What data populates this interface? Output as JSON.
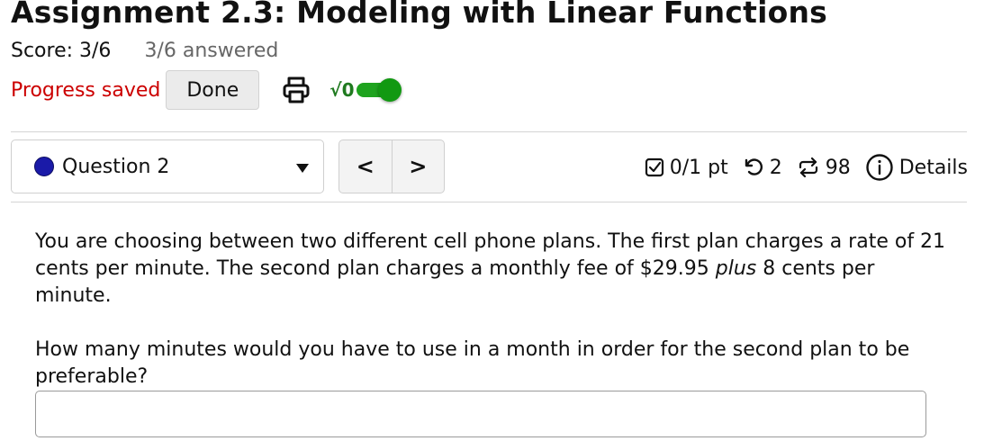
{
  "assignment": {
    "title": "Assignment 2.3: Modeling with Linear Functions",
    "score_label": "Score: 3/6",
    "answered_label": "3/6 answered"
  },
  "status": {
    "progress_saved": "Progress saved",
    "done_label": "Done",
    "math_toggle_label": "√0",
    "math_toggle_on": true
  },
  "question_nav": {
    "selected": "Question 2",
    "prev_label": "<",
    "next_label": ">"
  },
  "question_meta": {
    "points": "0/1 pt",
    "retries": "2",
    "attempts": "98",
    "details_label": "Details"
  },
  "question": {
    "paragraph1_a": "You are choosing between two different cell phone plans. The first plan charges a rate of 21 cents per minute. The second plan charges a monthly fee of $29.95 ",
    "paragraph1_em": "plus",
    "paragraph1_b": " 8 cents per minute.",
    "paragraph2": "How many minutes would you have to use in a month in order for the second plan to be preferable?",
    "answer_value": ""
  },
  "colors": {
    "saved_text": "#cc0000",
    "toggle_on": "#1fa31f",
    "question_dot": "#1a1aa8"
  },
  "icons": [
    "print-icon",
    "sqrt-icon",
    "checkbox-icon",
    "retry-icon",
    "repeat-icon",
    "info-icon"
  ]
}
